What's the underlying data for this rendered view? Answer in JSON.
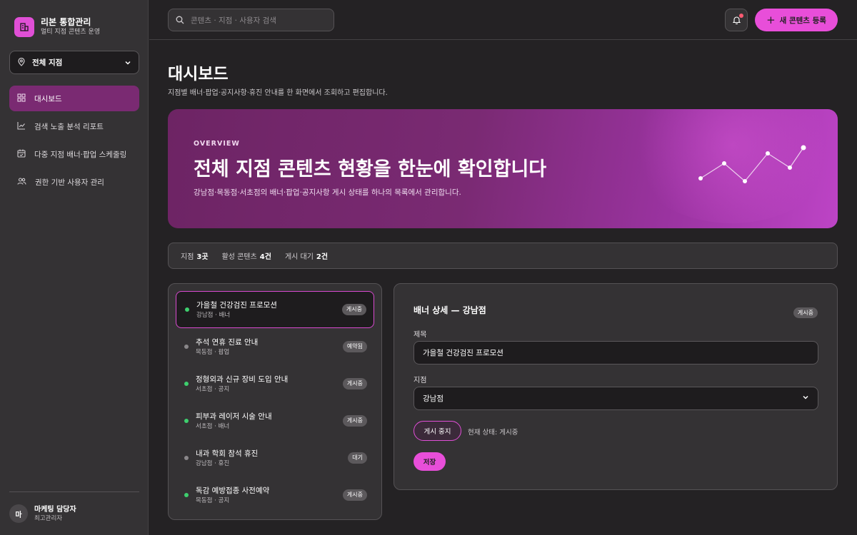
{
  "brand": {
    "title": "리본 통합관리",
    "subtitle": "멀티 지점 콘텐츠 운영"
  },
  "branch_select": {
    "value": "전체 지점"
  },
  "nav": {
    "items": [
      {
        "label": "대시보드",
        "icon": "grid-icon",
        "active": true
      },
      {
        "label": "검색 노출 분석 리포트",
        "icon": "trend-chart-icon"
      },
      {
        "label": "다중 지점 배너·팝업 스케줄링",
        "icon": "calendar-icon"
      },
      {
        "label": "권한 기반 사용자 관리",
        "icon": "users-icon"
      }
    ]
  },
  "user": {
    "initial": "마",
    "name": "마케팅 담당자",
    "role": "최고관리자"
  },
  "topbar": {
    "search_placeholder": "콘텐츠 · 지점 · 사용자 검색",
    "new_button": "새 콘텐츠 등록",
    "new_button_icon": "+"
  },
  "page": {
    "title": "대시보드",
    "description": "지점별 배너·팝업·공지사항·휴진 안내를 한 화면에서 조회하고 편집합니다."
  },
  "hero": {
    "eyebrow": "OVERVIEW",
    "title": "전체 지점 콘텐츠 현황을 한눈에 확인합니다",
    "subtitle": "강남점·목동점·서초점의 배너·팝업·공지사항 게시 상태를 하나의 목록에서 관리합니다."
  },
  "stats": [
    {
      "label": "지점",
      "value": "3곳"
    },
    {
      "label": "활성 콘텐츠",
      "value": "4건"
    },
    {
      "label": "게시 대기",
      "value": "2건"
    }
  ],
  "content_list": [
    {
      "title": "가을철 건강검진 프로모션",
      "meta": "강남점 · 배너",
      "status": "게시중",
      "dot": "green",
      "selected": true
    },
    {
      "title": "추석 연휴 진료 안내",
      "meta": "목동점 · 팝업",
      "status": "예약됨",
      "dot": "gray"
    },
    {
      "title": "정형외과 신규 장비 도입 안내",
      "meta": "서초점 · 공지",
      "status": "게시중",
      "dot": "green"
    },
    {
      "title": "피부과 레이저 시술 안내",
      "meta": "서초점 · 배너",
      "status": "게시중",
      "dot": "green"
    },
    {
      "title": "내과 학회 참석 휴진",
      "meta": "강남점 · 휴진",
      "status": "대기",
      "dot": "gray"
    },
    {
      "title": "독감 예방접종 사전예약",
      "meta": "목동점 · 공지",
      "status": "게시중",
      "dot": "green"
    }
  ],
  "detail": {
    "title": "배너 상세 — 강남점",
    "status_badge": "게시중",
    "title_label": "제목",
    "title_value": "가을철 건강검진 프로모션",
    "branch_label": "지점",
    "branch_value": "강남점",
    "pause_button": "게시 중지",
    "current_status": "현재 상태: 게시중",
    "save_button": "저장"
  },
  "colors": {
    "accent": "#e84ed9",
    "active_nav": "#7a2a72",
    "status_green": "#3ecf6e"
  }
}
